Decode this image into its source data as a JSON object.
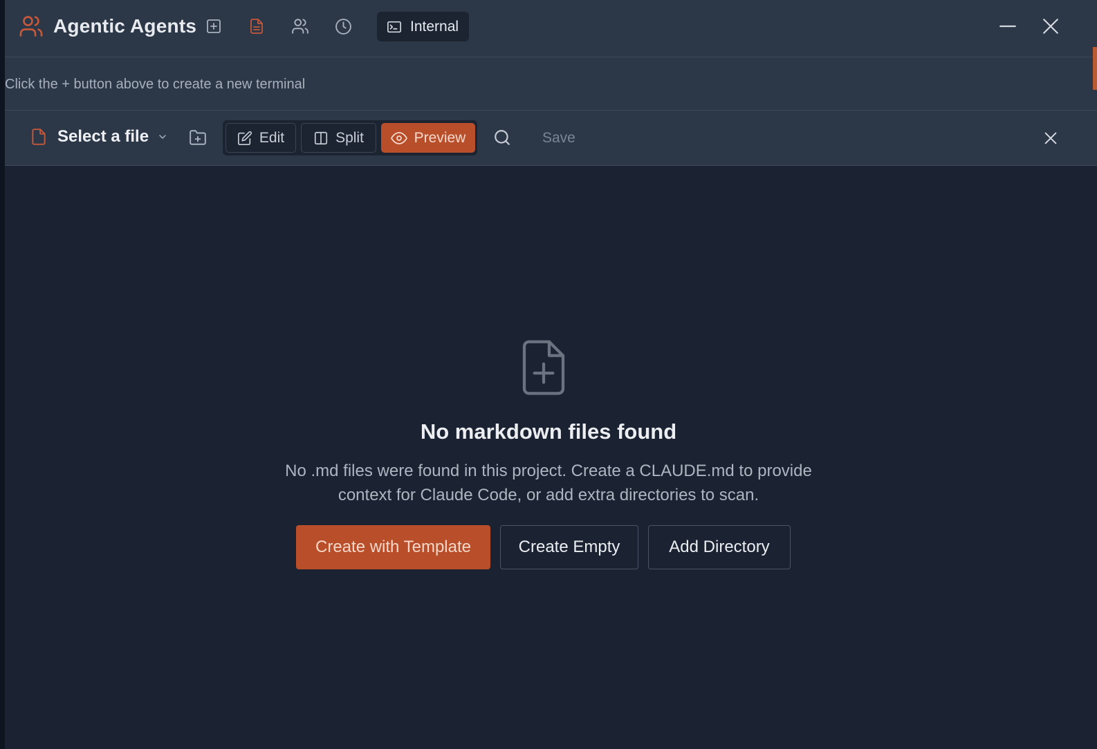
{
  "header": {
    "app_name": "Agentic Agents",
    "internal_label": "Internal"
  },
  "hint": {
    "text": "Click the + button above to create a new terminal"
  },
  "toolbar": {
    "file_select_label": "Select a file",
    "edit_label": "Edit",
    "split_label": "Split",
    "preview_label": "Preview",
    "save_label": "Save",
    "active_view": "Preview"
  },
  "empty_state": {
    "title": "No markdown files found",
    "description": "No .md files were found in this project. Create a CLAUDE.md to provide context for Claude Code, or add extra directories to scan.",
    "buttons": {
      "create_template": "Create with Template",
      "create_empty": "Create Empty",
      "add_directory": "Add Directory"
    }
  },
  "icons": {
    "app": "users-icon",
    "new_terminal": "plus-square-icon",
    "files": "file-text-icon",
    "agents": "users-icon",
    "history": "clock-icon",
    "terminal": "terminal-icon"
  },
  "colors": {
    "accent": "#b84f2a",
    "titlebar_bg": "#2c3748",
    "content_bg": "#1b2333"
  }
}
